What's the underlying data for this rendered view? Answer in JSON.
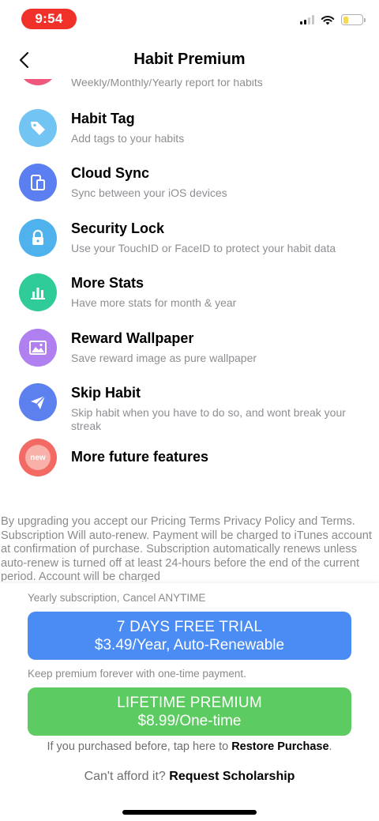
{
  "status_bar": {
    "time": "9:54"
  },
  "nav": {
    "title": "Habit Premium"
  },
  "features": [
    {
      "title": "",
      "desc": "Weekly/Monthly/Yearly report for habits",
      "color": "#f0577d",
      "icon": "report-icon"
    },
    {
      "title": "Habit Tag",
      "desc": "Add tags to your habits",
      "color": "#72c5f2",
      "icon": "tag-icon"
    },
    {
      "title": "Cloud Sync",
      "desc": "Sync between your iOS devices",
      "color": "#5b7ef0",
      "icon": "devices-icon"
    },
    {
      "title": "Security Lock",
      "desc": "Use your TouchID or FaceID to protect your habit data",
      "color": "#4fb2ec",
      "icon": "lock-icon"
    },
    {
      "title": "More Stats",
      "desc": "Have more stats for month & year",
      "color": "#2fcc9a",
      "icon": "bar-chart-icon"
    },
    {
      "title": "Reward Wallpaper",
      "desc": "Save reward image as pure wallpaper",
      "color": "#b07ff0",
      "icon": "image-icon"
    },
    {
      "title": "Skip Habit",
      "desc": "Skip habit when you have to do so, and wont break your streak",
      "color": "#5d80ef",
      "icon": "paper-plane-icon"
    },
    {
      "title": "More future features",
      "desc": "",
      "color": "#f26a63",
      "icon": "new-badge-icon",
      "badge": "new"
    }
  ],
  "terms": "By upgrading you accept our Pricing Terms Privacy Policy and Terms. Subscription Will auto-renew. Payment will be charged to iTunes account at confirmation of purchase. Subscription automatically renews unless auto-renew is turned off at least 24-hours before the end of the current period. Account will be charged",
  "subscription": {
    "note": "Yearly subscription, Cancel ANYTIME",
    "trial_line1": "7 DAYS FREE TRIAL",
    "trial_line2": "$3.49/Year, Auto-Renewable",
    "lifetime_note": "Keep premium forever with one-time payment.",
    "lifetime_line1": "LIFETIME PREMIUM",
    "lifetime_line2": "$8.99/One-time",
    "restore_prefix": "If you purchased before, tap here to ",
    "restore_link": "Restore Purchase",
    "restore_suffix": ".",
    "scholar_prefix": "Can't afford it? ",
    "scholar_link": "Request Scholarship"
  },
  "colors": {
    "trial": "#4a8cf3",
    "lifetime": "#5ccb62",
    "time_pill": "#f0312a"
  }
}
